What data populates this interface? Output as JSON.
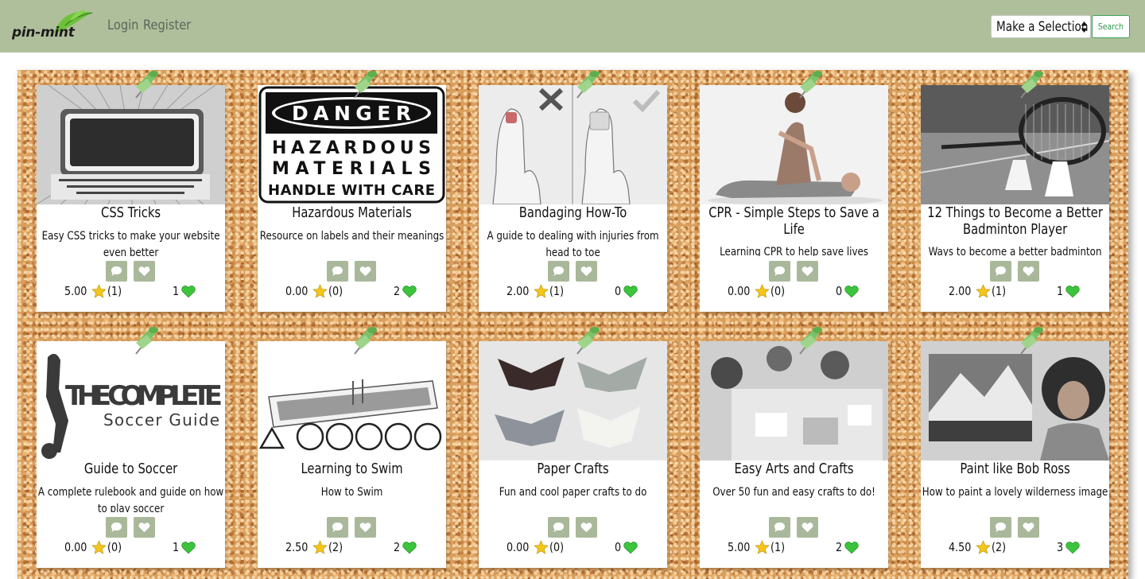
{
  "brand": {
    "name": "pin-mint"
  },
  "nav": {
    "login": "Login",
    "register": "Register"
  },
  "search": {
    "select_value": "Make a Selection",
    "button": "Search"
  },
  "cards": [
    {
      "title": "CSS Tricks",
      "description": "Easy CSS tricks to make your website even better",
      "rating": "5.00",
      "ratings_count": "(1)",
      "likes": "1",
      "image": "make-magic-with-css-poster"
    },
    {
      "title": "Hazardous Materials",
      "description": "Resource on labels and their meanings",
      "rating": "0.00",
      "ratings_count": "(0)",
      "likes": "2",
      "image": "danger-hazardous-materials-sign",
      "sign": {
        "danger": "DANGER",
        "line1": "HAZARDOUS",
        "line2": "MATERIALS",
        "line3": "HANDLE WITH CARE"
      }
    },
    {
      "title": "Bandaging How-To",
      "description": "A guide to dealing with injuries from head to toe",
      "rating": "2.00",
      "ratings_count": "(1)",
      "likes": "0",
      "image": "bandaged-finger-illustration"
    },
    {
      "title": "CPR - Simple Steps to Save a Life",
      "description": "Learning CPR to help save lives",
      "rating": "0.00",
      "ratings_count": "(0)",
      "likes": "0",
      "image": "cpr-photo"
    },
    {
      "title": "12 Things to Become a Better Badminton Player",
      "description": "Ways to become a better badminton player",
      "rating": "2.00",
      "ratings_count": "(1)",
      "likes": "1",
      "image": "badminton-racket-photo"
    },
    {
      "title": "Guide to Soccer",
      "description": "A complete rulebook and guide on how to play soccer",
      "rating": "0.00",
      "ratings_count": "(0)",
      "likes": "1",
      "image": "complete-soccer-guide-logo",
      "logo": {
        "line1": "THE COMPLETE",
        "line2": "Soccer Guide"
      }
    },
    {
      "title": "Learning to Swim",
      "description": "How to Swim",
      "rating": "2.50",
      "ratings_count": "(2)",
      "likes": "2",
      "image": "swimming-pool-illustration"
    },
    {
      "title": "Paper Crafts",
      "description": "Fun and cool paper crafts to do",
      "rating": "0.00",
      "ratings_count": "(0)",
      "likes": "0",
      "image": "origami-butterflies-photo"
    },
    {
      "title": "Easy Arts and Crafts",
      "description": "Over 50 fun and easy crafts to do!",
      "rating": "5.00",
      "ratings_count": "(1)",
      "likes": "2",
      "image": "kids-crafting-photo"
    },
    {
      "title": "Paint like Bob Ross",
      "description": "How to paint a lovely wilderness image",
      "rating": "4.50",
      "ratings_count": "(2)",
      "likes": "3",
      "image": "bob-ross-painting-photo"
    }
  ],
  "colors": {
    "navbar": "#afbf9c",
    "button": "#a9b89a",
    "heart": "#3cc43c",
    "star": "#f5c518",
    "search_border": "#3fa45a"
  },
  "icons": [
    "leaf-icon",
    "comment-icon",
    "heart-icon",
    "star-icon",
    "push-pin-icon",
    "select-arrows-icon"
  ]
}
